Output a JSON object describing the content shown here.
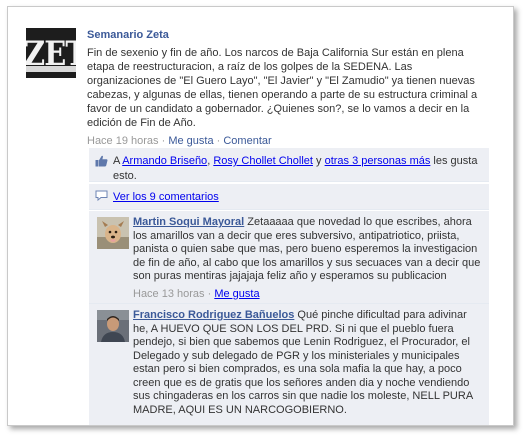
{
  "post": {
    "author": "Semanario Zeta",
    "avatar_logo_text": "ZET",
    "text": "Fin de sexenio y fin de año. Los narcos de Baja California Sur están en plena etapa de reestructuracion, a raíz de los golpes de la SEDENA. Las organizaciones de \"El Guero Layo\", \"El Javier\" y \"El Zamudio\" ya tienen nuevas cabezas, y algunas de ellas, tienen operando a parte de su estructura criminal a favor de un candidato a gobernador. ¿Quienes son?, se lo vamos a decir en la edición de Fin de Año.",
    "time": "Hace 19 horas",
    "sep": " · ",
    "like_label": "Me gusta",
    "comment_label": "Comentar"
  },
  "likes": {
    "prefix": "A ",
    "user1": "Armando Briseño",
    "sep1": ", ",
    "user2": "Rosy Chollet Chollet",
    "mid": " y ",
    "others": "otras 3 personas más",
    "suffix": " les gusta esto."
  },
  "view_comments": "Ver los 9 comentarios",
  "comments": [
    {
      "author": "Martin Soqui Mayoral",
      "text": " Zetaaaaa que novedad lo que escribes, ahora los amarillos van a decir que eres subversivo, antipatriotico, priista, panista o quien sabe que mas, pero bueno esperemos la investigacion de fin de año, al cabo que los amarillos y sus secuaces van a decir que son puras mentiras jajajaja feliz año y esperamos su publicacion",
      "time": "Hace 13 horas",
      "sep": " · ",
      "like_label": "Me gusta"
    },
    {
      "author": "Francisco Rodriguez Bañuelos",
      "text": " Qué pinche dificultad para adivinar he, A HUEVO QUE SON LOS DEL PRD. Si ni que el pueblo fuera pendejo, si bien que sabemos que Lenin Rodriguez, el Procurador, el Delegado y sub delegado de PGR y los ministeriales y municipales estan pero si bien comprados, es una sola mafia la que hay, a poco creen que es de gratis que los señores anden dia y noche vendiendo sus chingaderas en los carros sin que nadie los moleste, NELL PURA MADRE, AQUI ES UN NARCOGOBIERNO."
    }
  ],
  "colors": {
    "link": "#3b5998",
    "ufi_bg": "#edeff4",
    "meta_gray": "#999999"
  },
  "icons": {
    "like": "thumbs-up-icon",
    "comments": "comment-bubble-icon"
  }
}
